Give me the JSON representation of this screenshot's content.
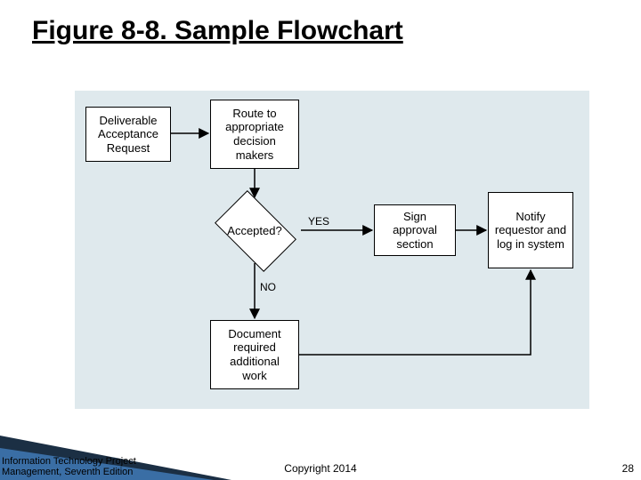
{
  "title": "Figure 8-8. Sample Flowchart",
  "nodes": {
    "deliverable": "Deliverable Acceptance Request",
    "route": "Route to appropriate decision makers",
    "decision": "Accepted?",
    "sign": "Sign approval section",
    "notify": "Notify requestor and log in system",
    "document": "Document required additional work"
  },
  "labels": {
    "yes": "YES",
    "no": "NO"
  },
  "footer": {
    "left_line1": "Information Technology Project",
    "left_line2": "Management, Seventh Edition",
    "center": "Copyright 2014",
    "right": "28"
  },
  "chart_data": {
    "type": "flowchart",
    "title": "Figure 8-8. Sample Flowchart",
    "nodes": [
      {
        "id": "deliverable",
        "shape": "rect",
        "text": "Deliverable Acceptance Request"
      },
      {
        "id": "route",
        "shape": "rect",
        "text": "Route to appropriate decision makers"
      },
      {
        "id": "decision",
        "shape": "diamond",
        "text": "Accepted?"
      },
      {
        "id": "sign",
        "shape": "rect",
        "text": "Sign approval section"
      },
      {
        "id": "notify",
        "shape": "rect",
        "text": "Notify requestor and log in system"
      },
      {
        "id": "document",
        "shape": "rect",
        "text": "Document required additional work"
      }
    ],
    "edges": [
      {
        "from": "deliverable",
        "to": "route",
        "label": ""
      },
      {
        "from": "route",
        "to": "decision",
        "label": ""
      },
      {
        "from": "decision",
        "to": "sign",
        "label": "YES"
      },
      {
        "from": "sign",
        "to": "notify",
        "label": ""
      },
      {
        "from": "decision",
        "to": "document",
        "label": "NO"
      },
      {
        "from": "document",
        "to": "notify",
        "label": ""
      }
    ]
  }
}
